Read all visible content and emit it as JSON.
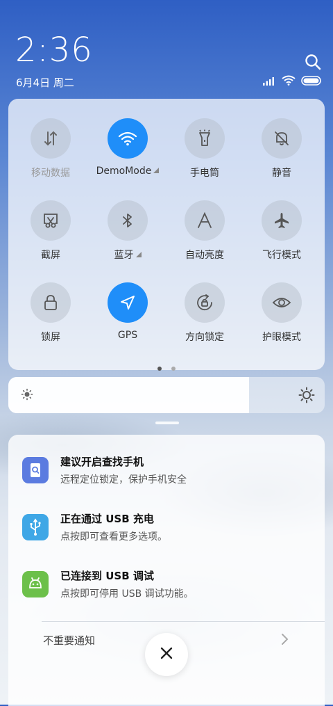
{
  "header": {
    "time": "2:36",
    "date": "6月4日 周二"
  },
  "quick_settings": [
    {
      "label": "移动数据",
      "icon": "mobile-data-icon",
      "active": false,
      "dim": true
    },
    {
      "label": "DemoMode",
      "icon": "wifi-icon",
      "active": true,
      "expand": true
    },
    {
      "label": "手电筒",
      "icon": "flashlight-icon",
      "active": false
    },
    {
      "label": "静音",
      "icon": "mute-bell-icon",
      "active": false
    },
    {
      "label": "截屏",
      "icon": "screenshot-icon",
      "active": false
    },
    {
      "label": "蓝牙",
      "icon": "bluetooth-icon",
      "active": false,
      "expand": true
    },
    {
      "label": "自动亮度",
      "icon": "auto-brightness-icon",
      "active": false
    },
    {
      "label": "飞行模式",
      "icon": "airplane-icon",
      "active": false
    },
    {
      "label": "锁屏",
      "icon": "lock-icon",
      "active": false
    },
    {
      "label": "GPS",
      "icon": "gps-icon",
      "active": true
    },
    {
      "label": "方向锁定",
      "icon": "rotation-lock-icon",
      "active": false
    },
    {
      "label": "护眼模式",
      "icon": "eye-icon",
      "active": false
    }
  ],
  "pager": {
    "pages": 2,
    "current": 1
  },
  "brightness": {
    "level": 0.76
  },
  "notifications": [
    {
      "title": "建议开启查找手机",
      "body": "远程定位锁定，保护手机安全",
      "icon": "find-phone-icon",
      "color": "#5b7be0"
    },
    {
      "title": "正在通过 USB 充电",
      "body": "点按即可查看更多选项。",
      "icon": "usb-icon",
      "color": "#3fa7e6"
    },
    {
      "title": "已连接到 USB 调试",
      "body": "点按即可停用 USB 调试功能。",
      "icon": "android-icon",
      "color": "#6cc04a"
    }
  ],
  "footer": {
    "unimportant_label": "不重要通知"
  },
  "colors": {
    "accent": "#1f8ef9"
  }
}
